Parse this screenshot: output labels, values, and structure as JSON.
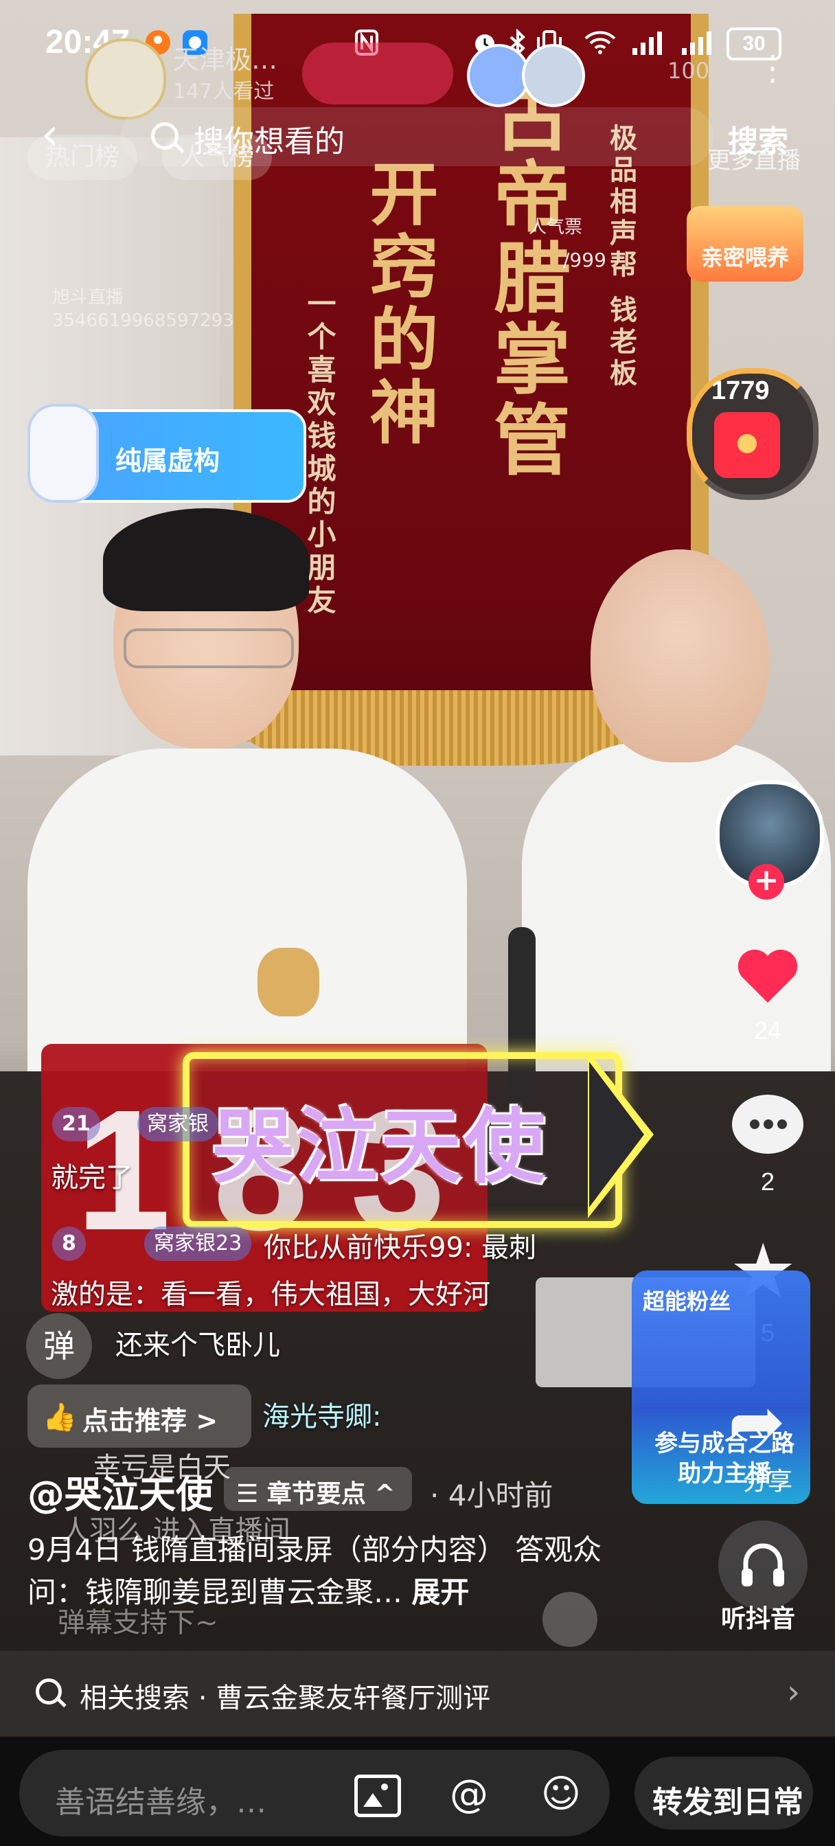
{
  "status_bar": {
    "time": "20:47",
    "battery": "30",
    "icons": [
      "nfc-icon",
      "alarm-icon",
      "bluetooth-icon",
      "vibrate-icon",
      "wifi-icon",
      "signal-icon",
      "signal-icon"
    ]
  },
  "live_header": {
    "name": "天津极…",
    "watching": "147人看过",
    "viewer_count": "100"
  },
  "search": {
    "back_symbol": "‹",
    "placeholder": "搜你想看的",
    "button_label": "搜索"
  },
  "chips": {
    "hot_list": "热门榜",
    "popularity_list": "人气榜",
    "more_live": "更多直播"
  },
  "overlay": {
    "popularity_ticket": "人气票",
    "popularity_progress": "/999",
    "room_id": "旭斗直播\n3546619968597293",
    "intimacy_badge": "亲密喂养",
    "virtual_tag": "纯属虚构",
    "name_sticker": "哭泣天使"
  },
  "banner": {
    "big_col_1": "开窍的神",
    "big_col_2": "古帝腊掌管",
    "small_col_1": "一个喜欢钱城的小朋友",
    "small_col_2": "极品相声帮 钱老板"
  },
  "calendar_digits": [
    "1",
    "8",
    "3"
  ],
  "right_rail": {
    "redpack_count": "1779",
    "like_count": "24",
    "comment_count": "2",
    "favorite_count": "5",
    "share_label": "分享",
    "listen_label": "听抖音",
    "promo_title": "超能粉丝",
    "promo_sub": "参与成合之路 助力主播"
  },
  "chat": [
    {
      "level": "21",
      "fan": "窝家银",
      "text": "就完了"
    },
    {
      "level": "8",
      "fan": "窝家银23",
      "text": "你比从前快乐99: 最刺"
    },
    {
      "text": "激的是：看一看，伟大祖国，大好河"
    },
    {
      "text": "还来个飞卧儿"
    },
    {
      "text": "海光寺卿:"
    },
    {
      "text": "幸亏是白天"
    },
    {
      "text": "人羽么 进入直播间"
    },
    {
      "text": "弹幕支持下~"
    }
  ],
  "controls": {
    "danmu_button": "弹",
    "recommend_label": "点击推荐 >"
  },
  "post": {
    "handle": "@哭泣天使",
    "chapter_label": "☰ 章节要点 ^",
    "time_ago": "· 4小时前",
    "caption": "9月4日 钱隋直播间录屏（部分内容） 答观众问：钱隋聊姜昆到曹云金聚…",
    "expand_label": "展开"
  },
  "related_search": {
    "label": "相关搜索 · 曹云金聚友轩餐厅测评",
    "chevron": "›"
  },
  "bottom_bar": {
    "input_placeholder": "善语结善缘，…",
    "at_symbol": "@",
    "emoji_symbol": "☺",
    "forward_label": "转发到日常"
  },
  "colors": {
    "brand_red": "#fe2c55",
    "banner_red": "#7d0a10",
    "gold": "#d4a54a",
    "sticker_yellow": "#fff45a"
  }
}
